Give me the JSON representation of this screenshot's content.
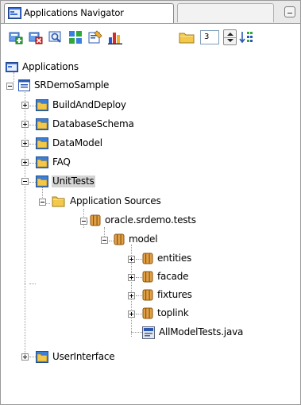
{
  "tab": {
    "title": "Applications Navigator",
    "icon": "applications-navigator-icon"
  },
  "toolbar": {
    "level_value": "3",
    "buttons": [
      "add-to-project-icon",
      "remove-from-project-icon",
      "find-icon",
      "synchronize-icon",
      "edit-icon",
      "chart-icon",
      "folder-icon",
      "spinner-icon",
      "sort-icon"
    ]
  },
  "tree": {
    "root": "Applications",
    "workspace": "SRDemoSample",
    "projects": [
      "BuildAndDeploy",
      "DatabaseSchema",
      "DataModel",
      "FAQ",
      "UnitTests",
      "UserInterface"
    ],
    "app_sources": "Application Sources",
    "package": "oracle.srdemo.tests",
    "model": "model",
    "subpackages": [
      "entities",
      "facade",
      "fixtures",
      "toplink"
    ],
    "java_file": "AllModelTests.java"
  },
  "colors": {
    "accent_blue": "#2a63c6",
    "folder_yellow": "#f3c84b",
    "package_orange": "#c87a1e",
    "selection_gray": "#d4d4d4"
  }
}
